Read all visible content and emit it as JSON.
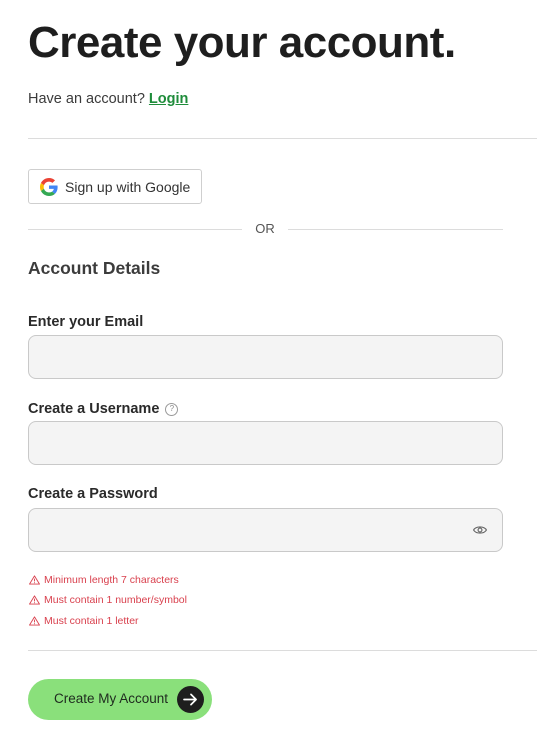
{
  "header": {
    "title": "Create your account.",
    "have_account_text": "Have an account?",
    "login_link": "Login"
  },
  "google": {
    "label": "Sign up with Google",
    "icon": "google-g-icon"
  },
  "separator": {
    "text": "OR"
  },
  "form": {
    "section_title": "Account Details",
    "email": {
      "label": "Enter your Email",
      "value": "",
      "placeholder": ""
    },
    "username": {
      "label": "Create a Username",
      "value": "",
      "placeholder": "",
      "help_icon": "question-circle-icon"
    },
    "password": {
      "label": "Create a Password",
      "value": "",
      "placeholder": "",
      "toggle_icon": "eye-icon"
    }
  },
  "validation": {
    "icon": "warning-triangle-icon",
    "rules": [
      "Minimum length 7 characters",
      "Must contain 1 number/symbol",
      "Must contain 1 letter"
    ]
  },
  "submit": {
    "label": "Create My Account",
    "icon": "arrow-right-icon"
  },
  "colors": {
    "link": "#1e8c3a",
    "error": "#d9414e",
    "button_bg": "#8ae07b",
    "input_bg": "#f4f4f4"
  }
}
